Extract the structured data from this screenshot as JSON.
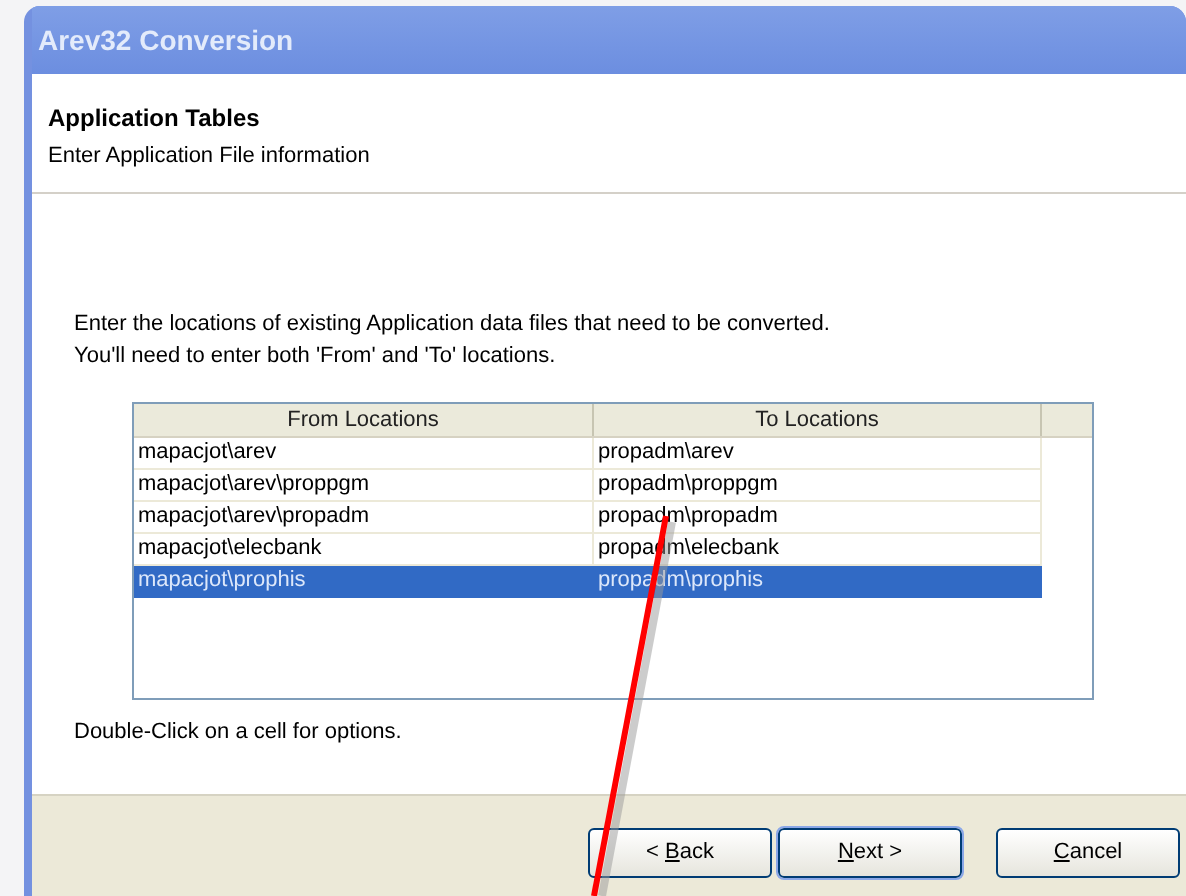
{
  "window": {
    "title": "Arev32 Conversion"
  },
  "header": {
    "title": "Application Tables",
    "subtitle": "Enter Application File information"
  },
  "instructions": "Enter the locations of existing Application data files that need to be converted.\nYou'll need to enter both 'From' and 'To' locations.",
  "table": {
    "columns": [
      "From Locations",
      "To Locations"
    ],
    "rows": [
      {
        "from": "mapacjot\\arev",
        "to": "propadm\\arev",
        "selected": false
      },
      {
        "from": "mapacjot\\arev\\proppgm",
        "to": "propadm\\proppgm",
        "selected": false
      },
      {
        "from": "mapacjot\\arev\\propadm",
        "to": "propadm\\propadm",
        "selected": false
      },
      {
        "from": "mapacjot\\elecbank",
        "to": "propadm\\elecbank",
        "selected": false
      },
      {
        "from": "mapacjot\\prophis",
        "to": "propadm\\prophis",
        "selected": true
      }
    ]
  },
  "hint": "Double-Click on a cell for options.",
  "buttons": [
    {
      "before": "< ",
      "access_key": "B",
      "after": "ack"
    },
    {
      "access_key": "N",
      "after": "ext >"
    },
    {
      "access_key": "C",
      "after": "ancel"
    }
  ]
}
